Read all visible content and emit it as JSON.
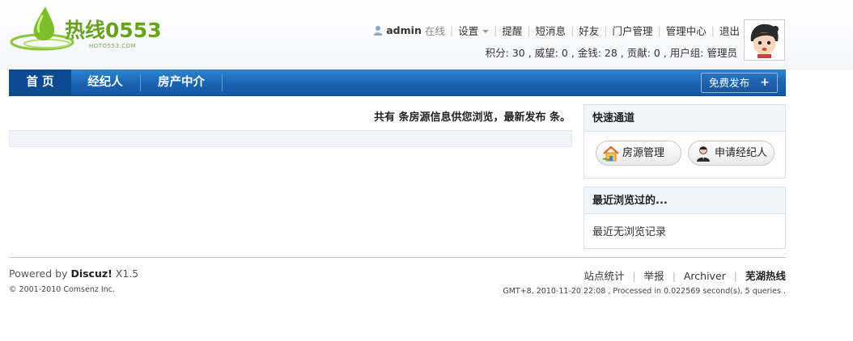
{
  "logo": {
    "text": "热线0553",
    "subtext": "HOTO553.COM"
  },
  "userbar": {
    "username": "admin",
    "status": "在线",
    "links": [
      "设置",
      "提醒",
      "短消息",
      "好友",
      "门户管理",
      "管理中心",
      "退出"
    ]
  },
  "stats": {
    "text": "积分: 30 , 威望: 0 , 金钱: 28 , 贡献: 0 , 用户组: 管理员"
  },
  "nav": {
    "items": [
      "首 页",
      "经纪人",
      "房产中介"
    ],
    "post_button": "免费发布",
    "post_plus": "+"
  },
  "main": {
    "summary": "共有 条房源信息供您浏览，最新发布 条。"
  },
  "sidebar": {
    "quick_title": "快速通道",
    "quick_buttons": [
      "房源管理",
      "申请经纪人"
    ],
    "recent_title": "最近浏览过的...",
    "recent_empty": "最近无浏览记录"
  },
  "footer": {
    "powered_prefix": "Powered by ",
    "powered_product": "Discuz!",
    "powered_version": " X1.5",
    "copyright": "© 2001-2010 Comsenz Inc.",
    "links": [
      "站点统计",
      "举报",
      "Archiver"
    ],
    "site_name": "芜湖热线",
    "gmt": "GMT+8, 2010-11-20 22:08 , Processed in 0.022569 second(s), 5 queries ."
  },
  "colors": {
    "nav_blue": "#1a63b3",
    "logo_green": "#66a31a",
    "box_bg": "#f0f5fb"
  }
}
